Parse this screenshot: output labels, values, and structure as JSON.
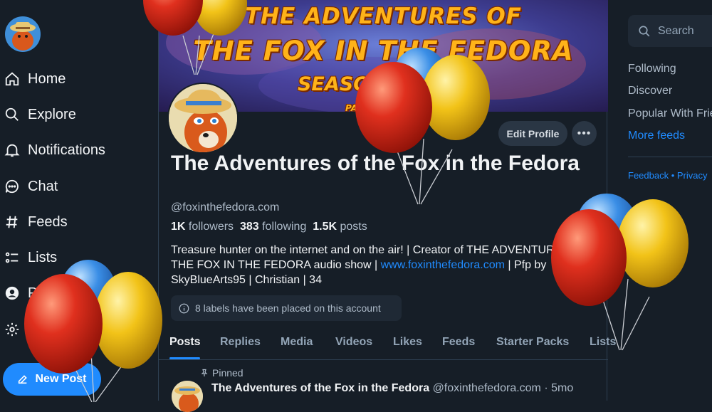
{
  "nav": {
    "items": [
      {
        "label": "Home",
        "icon": "home-icon"
      },
      {
        "label": "Explore",
        "icon": "search-icon"
      },
      {
        "label": "Notifications",
        "icon": "bell-icon"
      },
      {
        "label": "Chat",
        "icon": "chat-icon"
      },
      {
        "label": "Feeds",
        "icon": "hash-icon"
      },
      {
        "label": "Lists",
        "icon": "list-icon"
      },
      {
        "label": "Profile",
        "icon": "user-icon"
      },
      {
        "label": "Settings",
        "icon": "gear-icon"
      }
    ],
    "new_post": "New Post"
  },
  "banner": {
    "line1": "THE ADVENTURES OF",
    "line2": "THE FOX IN THE FEDORA",
    "line3": "SEASON FIVE",
    "line4": "PART II"
  },
  "profile": {
    "display_name": "The Adventures of the Fox in the Fedora",
    "handle": "@foxinthefedora.com",
    "followers_count": "1K",
    "followers_label": "followers",
    "following_count": "383",
    "following_label": "following",
    "posts_count": "1.5K",
    "posts_label": "posts",
    "bio_part1": "Treasure hunter on the internet and on the air! | Creator of THE ADVENTURES OF THE FOX IN THE FEDORA audio show | ",
    "bio_link": "www.foxinthefedora.com",
    "bio_part2": " | Pfp by SkyBlueArts95 | Christian | 34",
    "edit_label": "Edit Profile",
    "more_label": "•••",
    "labels_notice": "8 labels have been placed on this account"
  },
  "tabs": [
    "Posts",
    "Replies",
    "Media",
    "Videos",
    "Likes",
    "Feeds",
    "Starter Packs",
    "Lists"
  ],
  "post": {
    "pinned": "Pinned",
    "author": "The Adventures of the Fox in the Fedora",
    "handle": "@foxinthefedora.com",
    "time": " · 5mo"
  },
  "right": {
    "search_placeholder": "Search",
    "feeds": [
      "Following",
      "Discover",
      "Popular With Friends",
      "More feeds"
    ],
    "footer_feedback": "Feedback",
    "footer_sep": " • ",
    "footer_privacy": "Privacy"
  },
  "colors": {
    "background": "#161e27",
    "accent": "#208bfe",
    "balloon_red": "#d62418",
    "balloon_yellow": "#f2c318",
    "balloon_blue": "#3a8ee6"
  }
}
